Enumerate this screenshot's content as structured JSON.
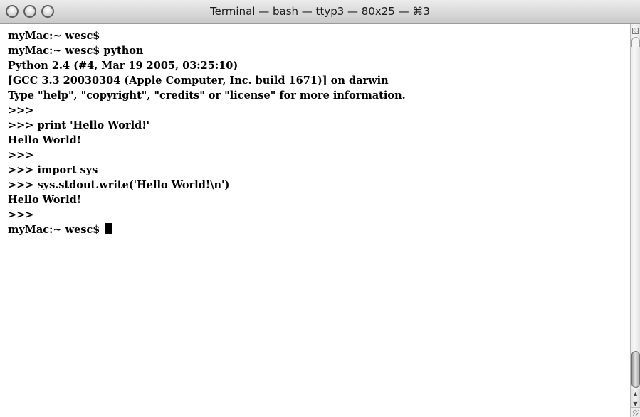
{
  "window": {
    "title": "Terminal — bash — ttyp3 — 80x25 — ⌘3",
    "controls": {
      "close_icon": "close-icon",
      "minimize_icon": "minimize-icon",
      "zoom_icon": "zoom-icon"
    }
  },
  "terminal": {
    "lines": [
      "myMac:~ wesc$",
      "myMac:~ wesc$ python",
      "Python 2.4 (#4, Mar 19 2005, 03:25:10)",
      "[GCC 3.3 20030304 (Apple Computer, Inc. build 1671)] on darwin",
      "Type \"help\", \"copyright\", \"credits\" or \"license\" for more information.",
      ">>>",
      ">>> print 'Hello World!'",
      "Hello World!",
      ">>>",
      ">>> import sys",
      ">>> sys.stdout.write('Hello World!\\n')",
      "Hello World!",
      ">>>",
      "myMac:~ wesc$ "
    ]
  },
  "scrollbar": {
    "up_arrow": "▲",
    "down_arrow": "▼"
  }
}
